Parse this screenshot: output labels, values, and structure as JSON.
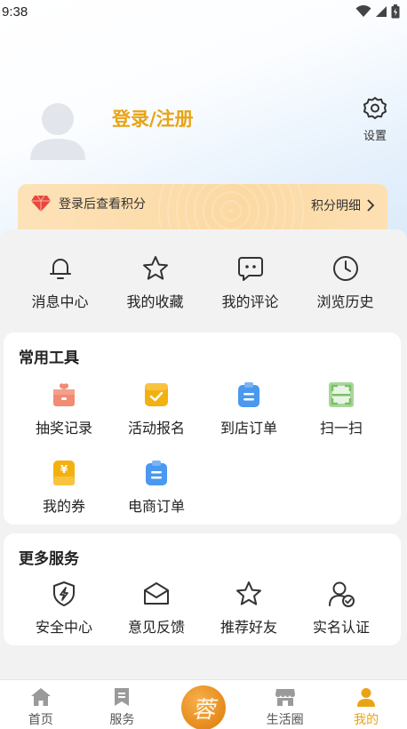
{
  "status_bar": {
    "time": "9:38"
  },
  "profile": {
    "login_label": "登录/注册",
    "settings_label": "设置"
  },
  "points_card": {
    "text": "登录后查看积分",
    "detail_label": "积分明细"
  },
  "quick_actions": [
    {
      "label": "消息中心",
      "icon": "bell-icon"
    },
    {
      "label": "我的收藏",
      "icon": "star-icon"
    },
    {
      "label": "我的评论",
      "icon": "comment-icon"
    },
    {
      "label": "浏览历史",
      "icon": "clock-icon"
    }
  ],
  "tools": {
    "title": "常用工具",
    "items": [
      {
        "label": "抽奖记录",
        "icon": "lottery-icon"
      },
      {
        "label": "活动报名",
        "icon": "signup-icon"
      },
      {
        "label": "到店订单",
        "icon": "store-order-icon"
      },
      {
        "label": "扫一扫",
        "icon": "scan-icon"
      },
      {
        "label": "我的券",
        "icon": "coupon-icon"
      },
      {
        "label": "电商订单",
        "icon": "ecommerce-order-icon"
      }
    ]
  },
  "services": {
    "title": "更多服务",
    "items": [
      {
        "label": "安全中心",
        "icon": "shield-icon"
      },
      {
        "label": "意见反馈",
        "icon": "feedback-mail-icon"
      },
      {
        "label": "推荐好友",
        "icon": "star-outline-icon"
      },
      {
        "label": "实名认证",
        "icon": "user-verify-icon"
      }
    ]
  },
  "tabbar": {
    "items": [
      {
        "label": "首页",
        "icon": "home-icon"
      },
      {
        "label": "服务",
        "icon": "bookmark-icon"
      },
      {
        "label": "",
        "icon": "center-logo-icon"
      },
      {
        "label": "生活圈",
        "icon": "shop-icon"
      },
      {
        "label": "我的",
        "icon": "profile-icon"
      }
    ],
    "active_index": 4
  },
  "colors": {
    "accent": "#e8a416",
    "text": "#222222",
    "page_bg": "#f2f2f2"
  }
}
